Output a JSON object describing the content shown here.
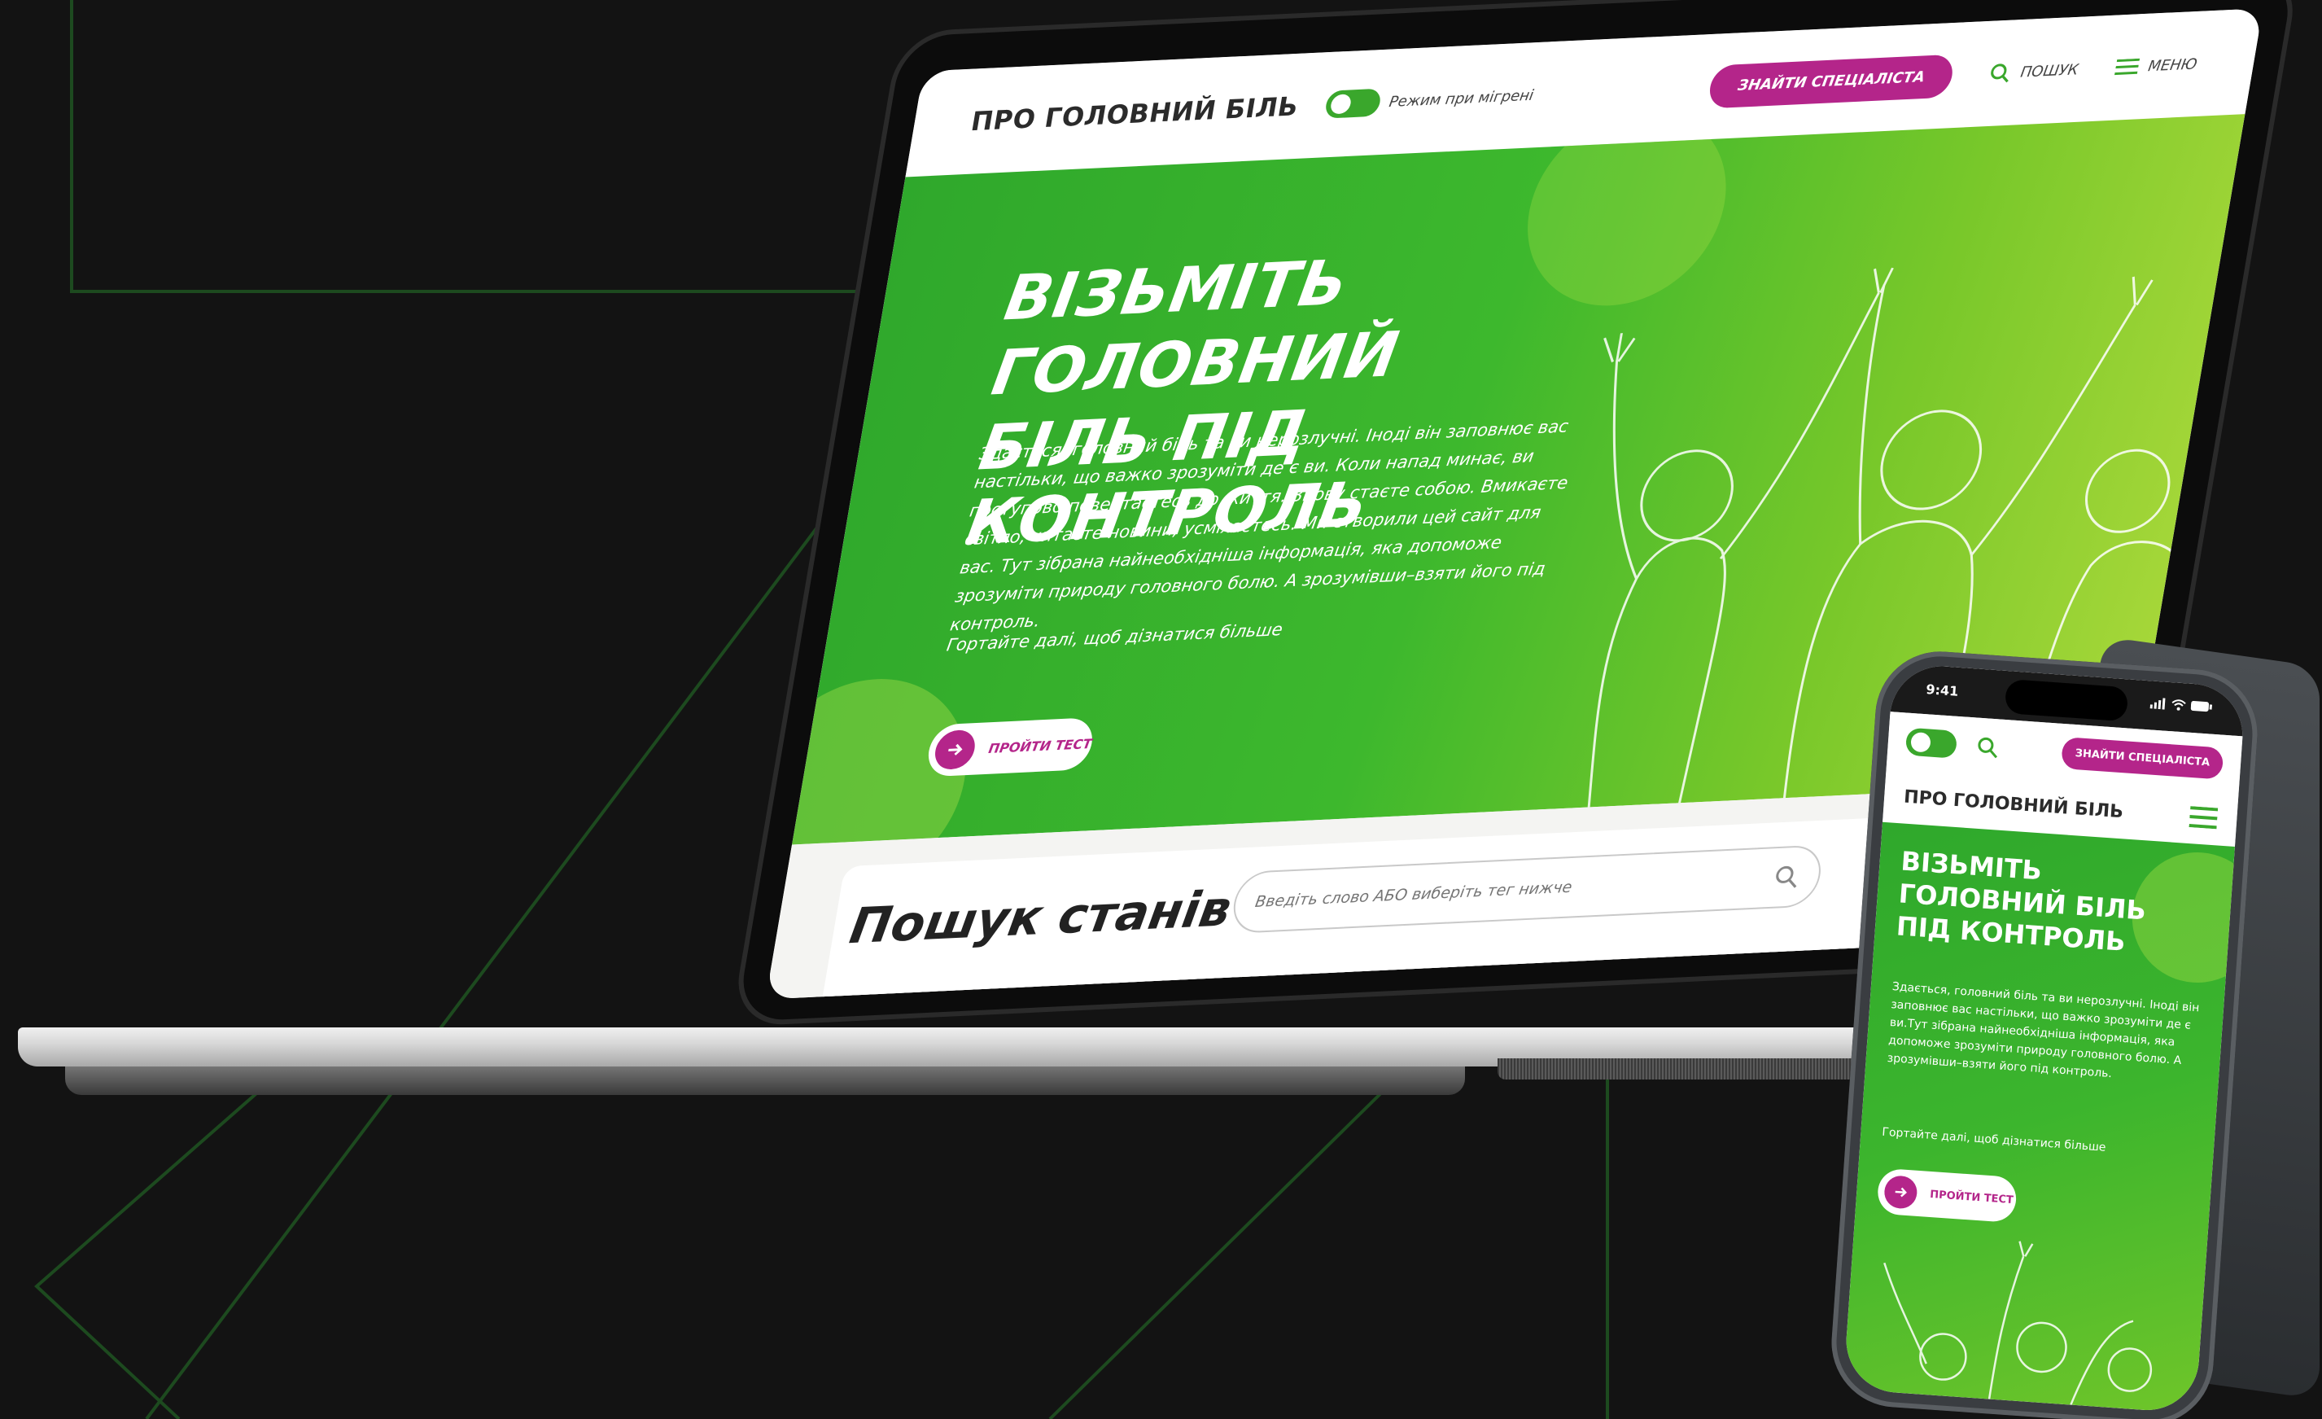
{
  "colors": {
    "background": "#131313",
    "accent_green": "#3aa72c",
    "cta_magenta": "#b4258a",
    "decor_line": "#1d4a1f"
  },
  "laptop": {
    "header": {
      "logo": "ПРО ГОЛОВНИЙ БІЛЬ",
      "toggle_label": "Режим при мігрені",
      "cta_label": "ЗНАЙТИ СПЕЦІАЛІСТА",
      "search_label": "ПОШУК",
      "menu_label": "МЕНЮ",
      "search_icon": "search-icon",
      "menu_icon": "hamburger-menu-icon"
    },
    "hero": {
      "title_line1": "ВІЗЬМІТЬ ГОЛОВНИЙ",
      "title_line2": "БІЛЬ ПІД КОНТРОЛЬ",
      "body": "Здається, головний біль та ви нерозлучні. Іноді він заповнює вас настільки, що важко зрозуміти де є ви. Коли напад минає, ви поступово повертаєтесь до життя. Знову стаєте собою. Вмикаєте світло, читаєте новини, усміхаєтесь. Ми створили цей сайт для вас. Тут зібрана найнеобхідніша інформація, яка допоможе зрозуміти природу головного болю. А зрозумівши–взяти його під контроль.",
      "scroll_hint": "Гортайте далі, щоб дізнатися більше",
      "test_button": "ПРОЙТИ ТЕСТ",
      "arrow_icon": "arrow-right-icon"
    },
    "search_section": {
      "title": "Пошук станів",
      "placeholder": "Введіть слово АБО виберіть тег нижче"
    }
  },
  "phone": {
    "status": {
      "time": "9:41"
    },
    "topbar": {
      "cta_label": "ЗНАЙТИ СПЕЦІАЛІСТА"
    },
    "logo": "ПРО ГОЛОВНИЙ БІЛЬ",
    "hero": {
      "title": "ВІЗЬМІТЬ ГОЛОВНИЙ БІЛЬ ПІД КОНТРОЛЬ",
      "body": "Здається, головний біль та ви нерозлучні. Іноді він заповнює вас настільки, що важко зрозуміти де є ви.Тут зібрана найнеобхідніша інформація, яка допоможе зрозуміти природу головного болю. А зрозумівши–взяти його під контроль.",
      "scroll_hint": "Гортайте далі, щоб дізнатися більше",
      "test_button": "ПРОЙТИ ТЕСТ"
    }
  }
}
